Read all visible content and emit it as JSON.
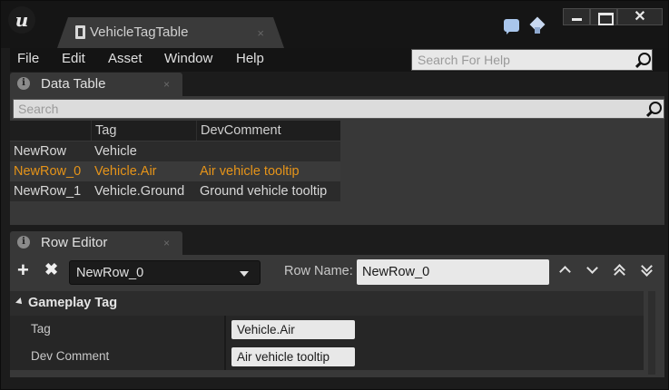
{
  "window": {
    "doc_tab_label": "VehicleTagTable",
    "doc_tab_close": "×",
    "close_glyph": "✕"
  },
  "menu": {
    "items": [
      "File",
      "Edit",
      "Asset",
      "Window",
      "Help"
    ],
    "help_search_placeholder": "Search For Help"
  },
  "data_table_panel": {
    "tab_label": "Data Table",
    "tab_close": "×",
    "info_glyph": "i",
    "search_placeholder": "Search",
    "columns": [
      "",
      "Tag",
      "DevComment"
    ],
    "rows": [
      {
        "name": "NewRow",
        "tag": "Vehicle",
        "dev_comment": ""
      },
      {
        "name": "NewRow_0",
        "tag": "Vehicle.Air",
        "dev_comment": "Air vehicle tooltip"
      },
      {
        "name": "NewRow_1",
        "tag": "Vehicle.Ground",
        "dev_comment": "Ground vehicle tooltip"
      }
    ],
    "selected_row_index": 1,
    "selected_color": "#e69419"
  },
  "row_editor_panel": {
    "tab_label": "Row Editor",
    "tab_close": "×",
    "info_glyph": "i",
    "add_glyph": "+",
    "remove_glyph": "✖",
    "selected_row": "NewRow_0",
    "row_name_label": "Row Name:",
    "row_name_value": "NewRow_0",
    "category_label": "Gameplay Tag",
    "properties": [
      {
        "label": "Tag",
        "value": "Vehicle.Air"
      },
      {
        "label": "Dev Comment",
        "value": "Air vehicle tooltip"
      }
    ]
  }
}
